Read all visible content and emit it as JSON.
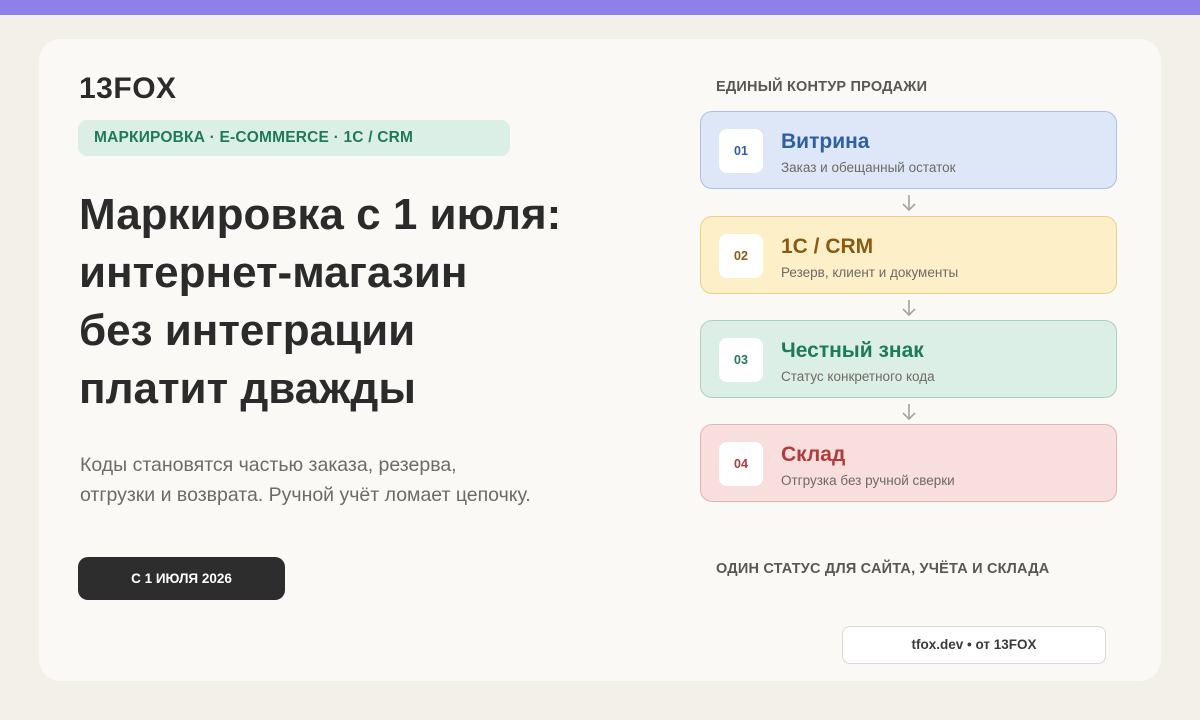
{
  "brand": "13FOX",
  "tagline": "МАРКИРОВКА · E-COMMERCE · 1С / CRM",
  "headline": [
    "Маркировка с 1 июля:",
    "интернет-магазин",
    "без интеграции",
    "платит дважды"
  ],
  "subtext": [
    "Коды становятся частью заказа, резерва,",
    "отгрузки и возврата. Ручной учёт ломает цепочку."
  ],
  "cta": "С 1 ИЮЛЯ 2026",
  "flow": {
    "title": "ЕДИНЫЙ КОНТУР ПРОДАЖИ",
    "steps": [
      {
        "num": "01",
        "title": "Витрина",
        "sub": "Заказ и обещанный остаток",
        "bg": "#dde7f8",
        "border": "#a9c0e8",
        "accent": "#2f5fa0"
      },
      {
        "num": "02",
        "title": "1С / CRM",
        "sub": "Резерв, клиент и документы",
        "bg": "#fdf0c9",
        "border": "#ead08a",
        "accent": "#8a5a12"
      },
      {
        "num": "03",
        "title": "Честный знак",
        "sub": "Статус конкретного кода",
        "bg": "#dcefe6",
        "border": "#a6d3bf",
        "accent": "#1f7a5a"
      },
      {
        "num": "04",
        "title": "Склад",
        "sub": "Отгрузка без ручной сверки",
        "bg": "#f8dedd",
        "border": "#e5b3b0",
        "accent": "#b23c3c"
      }
    ],
    "arrow_icon": "arrow-down-icon"
  },
  "footer_status": "ОДИН СТАТУС ДЛЯ САЙТА, УЧЁТА И СКЛАДА",
  "site": "tfox.dev • от 13FOX",
  "colors": {
    "top_bar": "#8f7fe8",
    "background": "#f3f0ea",
    "card": "#faf9f6",
    "cta": "#2d2d2d",
    "tag_bg": "#dcefe6",
    "tag_text": "#1f7a5a"
  }
}
